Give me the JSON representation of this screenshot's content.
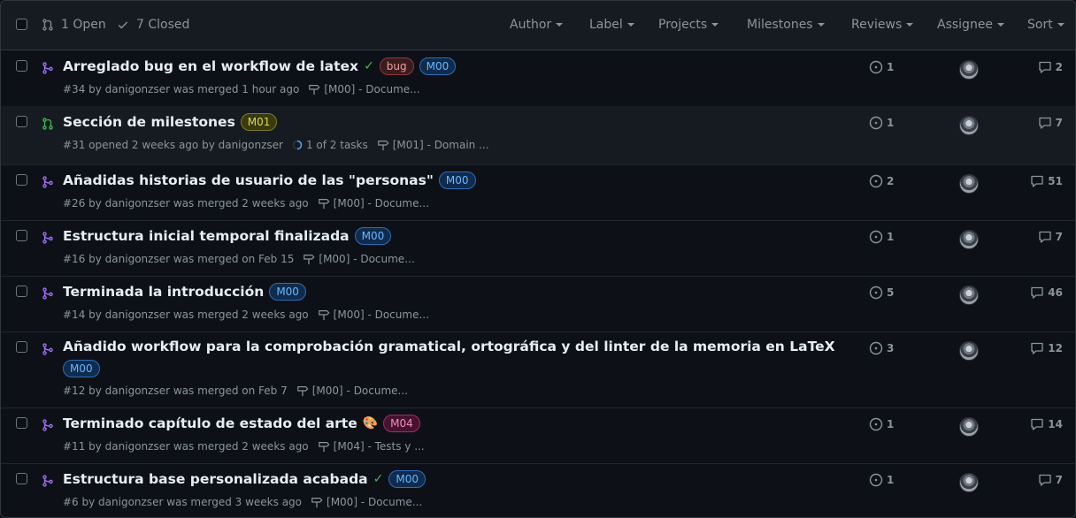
{
  "header": {
    "open_label": "1 Open",
    "closed_label": "7 Closed",
    "filters": [
      "Author",
      "Label",
      "Projects",
      "Milestones",
      "Reviews",
      "Assignee",
      "Sort"
    ]
  },
  "colors": {
    "background": "#0d1117",
    "merged_icon": "#a371f7",
    "open_icon": "#3fb950",
    "check": "#3fb950"
  },
  "pulls": [
    {
      "title": "Arreglado bug en el workflow de latex",
      "state": "merged",
      "check": true,
      "emoji": "",
      "labels": [
        {
          "text": "bug",
          "kind": "bug"
        },
        {
          "text": "M00",
          "kind": "m00"
        }
      ],
      "meta": "#34 by danigonzser was merged 1 hour ago",
      "tasks": "",
      "milestone": "[M00] - Docume...",
      "issues": "1",
      "comments": "2"
    },
    {
      "title": "Sección de milestones",
      "state": "open",
      "check": false,
      "emoji": "",
      "labels": [
        {
          "text": "M01",
          "kind": "m01"
        }
      ],
      "meta": "#31 opened 2 weeks ago by danigonzser",
      "tasks": "1 of 2 tasks",
      "milestone": "[M01] - Domain ...",
      "issues": "1",
      "comments": "7"
    },
    {
      "title": "Añadidas historias de usuario de las \"personas\"",
      "state": "merged",
      "check": false,
      "emoji": "",
      "labels": [
        {
          "text": "M00",
          "kind": "m00"
        }
      ],
      "meta": "#26 by danigonzser was merged 2 weeks ago",
      "tasks": "",
      "milestone": "[M00] - Docume...",
      "issues": "2",
      "comments": "51"
    },
    {
      "title": "Estructura inicial temporal finalizada",
      "state": "merged",
      "check": false,
      "emoji": "",
      "labels": [
        {
          "text": "M00",
          "kind": "m00"
        }
      ],
      "meta": "#16 by danigonzser was merged on Feb 15",
      "tasks": "",
      "milestone": "[M00] - Docume...",
      "issues": "1",
      "comments": "7"
    },
    {
      "title": "Terminada la introducción",
      "state": "merged",
      "check": false,
      "emoji": "",
      "labels": [
        {
          "text": "M00",
          "kind": "m00"
        }
      ],
      "meta": "#14 by danigonzser was merged 2 weeks ago",
      "tasks": "",
      "milestone": "[M00] - Docume...",
      "issues": "5",
      "comments": "46"
    },
    {
      "title": "Añadido workflow para la comprobación gramatical, ortográfica y del linter de la memoria en LaTeX",
      "state": "merged",
      "check": false,
      "emoji": "",
      "labels": [
        {
          "text": "M00",
          "kind": "m00"
        }
      ],
      "labels_wrap": true,
      "meta": "#12 by danigonzser was merged on Feb 7",
      "tasks": "",
      "milestone": "[M00] - Docume...",
      "issues": "3",
      "comments": "12"
    },
    {
      "title": "Terminado capítulo de estado del arte",
      "state": "merged",
      "check": false,
      "emoji": "🎨",
      "labels": [
        {
          "text": "M04",
          "kind": "m04"
        }
      ],
      "meta": "#11 by danigonzser was merged 2 weeks ago",
      "tasks": "",
      "milestone": "[M04] - Tests y ...",
      "issues": "1",
      "comments": "14"
    },
    {
      "title": "Estructura base personalizada acabada",
      "state": "merged",
      "check": true,
      "emoji": "",
      "labels": [
        {
          "text": "M00",
          "kind": "m00"
        }
      ],
      "meta": "#6 by danigonzser was merged 3 weeks ago",
      "tasks": "",
      "milestone": "[M00] - Docume...",
      "issues": "1",
      "comments": "7"
    }
  ]
}
